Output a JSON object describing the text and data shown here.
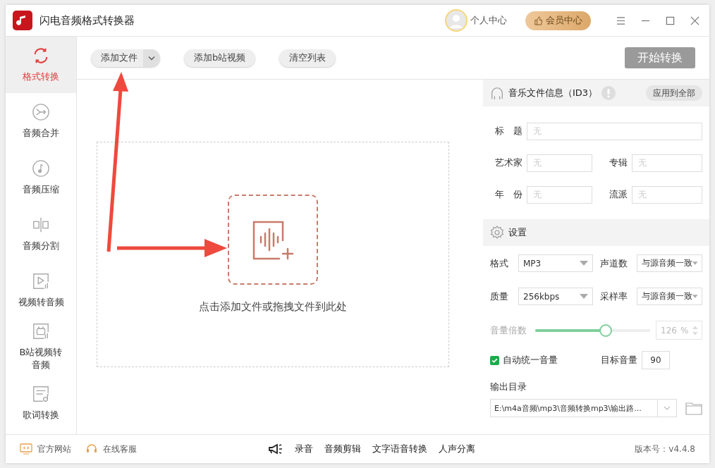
{
  "window": {
    "title": "闪电音频格式转换器"
  },
  "user": {
    "label": "个人中心"
  },
  "vip": {
    "label": "会员中心"
  },
  "sidebar": {
    "items": [
      {
        "kind": "convert",
        "label": "格式转换",
        "selected": true
      },
      {
        "kind": "merge",
        "label": "音频合并",
        "selected": false
      },
      {
        "kind": "compress",
        "label": "音频压缩",
        "selected": false
      },
      {
        "kind": "split",
        "label": "音频分割",
        "selected": false
      },
      {
        "kind": "video",
        "label": "视频转音频",
        "selected": false
      },
      {
        "kind": "bilibili",
        "label": "B站视频转音频",
        "selected": false
      },
      {
        "kind": "lyrics",
        "label": "歌词转换",
        "selected": false
      }
    ]
  },
  "toolbar": {
    "add_file": "添加文件",
    "add_bilibili": "添加b站视频",
    "clear": "清空列表",
    "start": "开始转换"
  },
  "drop_zone": {
    "hint": "点击添加文件或拖拽文件到此处"
  },
  "id3": {
    "title": "音乐文件信息（ID3）",
    "apply": "应用到全部",
    "rows": [
      [
        {
          "label": "标　题",
          "placeholder": "无"
        }
      ],
      [
        {
          "label": "艺术家",
          "placeholder": "无"
        },
        {
          "label": "专辑",
          "placeholder": "无"
        }
      ],
      [
        {
          "label": "年　份",
          "placeholder": "无"
        },
        {
          "label": "流派",
          "placeholder": "无"
        }
      ]
    ]
  },
  "settings": {
    "title": "设置",
    "rows": [
      [
        {
          "label": "格式",
          "value": "MP3"
        },
        {
          "label": "声道数",
          "value": "与源音频一致"
        }
      ],
      [
        {
          "label": "质量",
          "value": "256kbps"
        },
        {
          "label": "采样率",
          "value": "与源音频一致"
        }
      ]
    ],
    "volume": {
      "label": "音量倍数",
      "level": 0.61,
      "value": "126",
      "unit": "%"
    },
    "auto_volume": {
      "label": "自动统一音量",
      "checked": true
    },
    "target": {
      "label": "目标音量",
      "value": "90"
    },
    "output": {
      "label": "输出目录",
      "value": "E:\\m4a音频\\mp3\\音频转换mp3\\输出路..."
    }
  },
  "footer": {
    "links": [
      {
        "kind": "site",
        "label": "官方网站"
      },
      {
        "kind": "service",
        "label": "在线客服"
      }
    ],
    "tools": [
      "录音",
      "音频剪辑",
      "文字语音转换",
      "人声分离"
    ],
    "version": "版本号：v4.4.8"
  }
}
